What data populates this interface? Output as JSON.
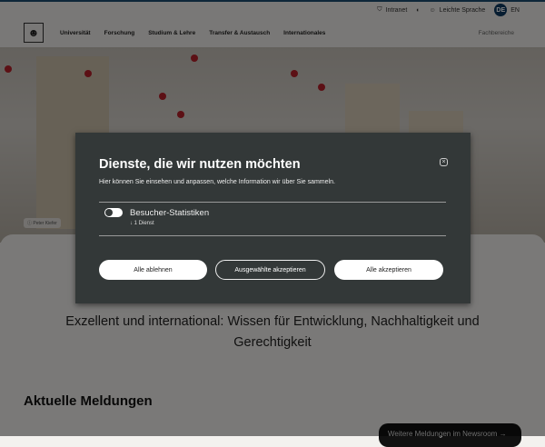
{
  "utility": {
    "intranet": "Intranet",
    "easy_language": "Leichte Sprache",
    "lang_de": "DE",
    "lang_en": "EN"
  },
  "nav": {
    "items": [
      "Universität",
      "Forschung",
      "Studium & Lehre",
      "Transfer & Austausch",
      "Internationales"
    ],
    "faculties": "Fachbereiche"
  },
  "hero": {
    "photo_credit": "Peter Kiefer"
  },
  "main": {
    "tagline": "Exzellent und international: Wissen für Entwicklung, Nachhaltigkeit und Gerechtigkeit",
    "news_heading": "Aktuelle Meldungen",
    "more_news": "Weitere Meldungen im Newsroom →"
  },
  "consent": {
    "title": "Dienste, die wir nutzen möchten",
    "description": "Hier können Sie einsehen und anpassen, welche Information wir über Sie sammeln.",
    "service": "Besucher-Statistiken",
    "service_count": "↓ 1 Dienst",
    "reject_all": "Alle ablehnen",
    "accept_selected": "Ausgewählte akzeptieren",
    "accept_all": "Alle akzeptieren"
  }
}
